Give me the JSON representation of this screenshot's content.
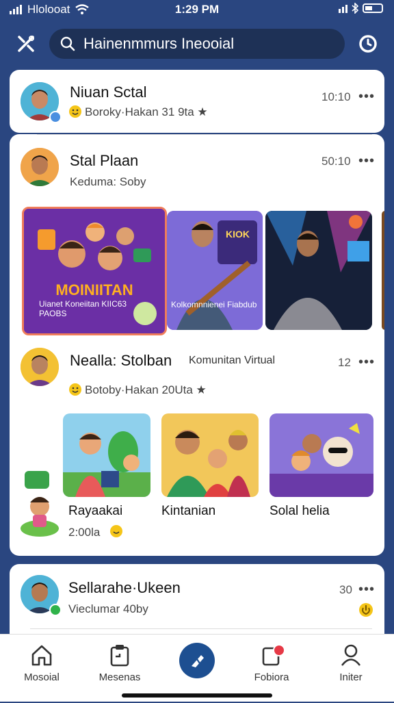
{
  "status": {
    "carrier": "Hlolooat",
    "time": "1:29 PM"
  },
  "search": {
    "text": "Hainenmmurs Ineooial"
  },
  "posts": [
    {
      "name": "Niuan Sctal",
      "sub": "Boroky·Hakan 31 9ta ★",
      "time": "10:10",
      "more": "•••"
    },
    {
      "name": "Stal Plaan",
      "sub": "Keduma: Soby",
      "time": "50:10",
      "more": "•••",
      "media": [
        {
          "title": "MOINIITAN",
          "caption": "Uianet Koneiitan KIIC63 PAOBS"
        },
        {
          "sign": "KIOK",
          "caption": "Kolkomnnienei Fiabdub"
        },
        {
          "caption": ""
        }
      ]
    },
    {
      "name": "Nealla: Stolban",
      "extra": "Komunitan Virtual",
      "sub": "Botoby·Hakan 20Uta ★",
      "time": "12",
      "more": "•••",
      "tiles": [
        {
          "label": "Rayaakai",
          "detail": "2:00la"
        },
        {
          "label": "Kintanian"
        },
        {
          "label": "Solal helia"
        }
      ]
    },
    {
      "name": "Sellarahe·Ukeen",
      "sub": "Vieclumar 40by",
      "time": "30",
      "more": "•••"
    }
  ],
  "tabs": [
    {
      "label": "Mosoial",
      "icon": "home-icon"
    },
    {
      "label": "Mesenas",
      "icon": "clipboard-icon"
    },
    {
      "label": "",
      "icon": "compose-icon"
    },
    {
      "label": "Fobiora",
      "icon": "notification-icon"
    },
    {
      "label": "Initer",
      "icon": "profile-icon"
    }
  ],
  "colors": {
    "background": "#2a4680",
    "search_bg": "#1e3156",
    "accent": "#1d4f91",
    "badge": "#e63946"
  }
}
